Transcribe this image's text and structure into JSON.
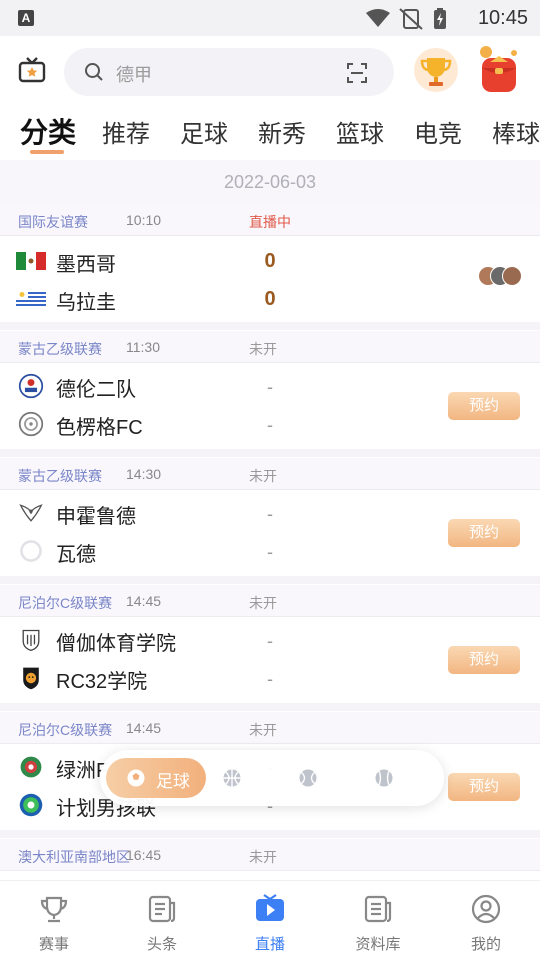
{
  "status_bar": {
    "time": "10:45",
    "app_badge": "A"
  },
  "search": {
    "placeholder": "德甲"
  },
  "tabs": [
    "分类",
    "推荐",
    "足球",
    "新秀",
    "篮球",
    "电竞",
    "棒球"
  ],
  "date": "2022-06-03",
  "matches": [
    {
      "league": "国际友谊赛",
      "time": "10:10",
      "status": "直播中",
      "home": "墨西哥",
      "away": "乌拉圭",
      "home_score": "0",
      "away_score": "0"
    },
    {
      "league": "蒙古乙级联赛",
      "time": "11:30",
      "status": "未开",
      "home": "德伦二队",
      "away": "色楞格FC",
      "home_score": "-",
      "away_score": "-",
      "action": "预约"
    },
    {
      "league": "蒙古乙级联赛",
      "time": "14:30",
      "status": "未开",
      "home": "申霍鲁德",
      "away": "瓦德",
      "home_score": "-",
      "away_score": "-",
      "action": "预约"
    },
    {
      "league": "尼泊尔C级联赛",
      "time": "14:45",
      "status": "未开",
      "home": "僧伽体育学院",
      "away": "RC32学院",
      "home_score": "-",
      "away_score": "-",
      "action": "预约"
    },
    {
      "league": "尼泊尔C级联赛",
      "time": "14:45",
      "status": "未开",
      "home": "绿洲F",
      "away": "计划男孩联",
      "home_score": "-",
      "away_score": "-",
      "action": "预约"
    },
    {
      "league": "澳大利亚南部地区",
      "time": "16:45",
      "status": "未开"
    }
  ],
  "sport_switch": {
    "active": "足球"
  },
  "bottom_nav": [
    "赛事",
    "头条",
    "直播",
    "资料库",
    "我的"
  ],
  "colors": {
    "accent": "#3d7ff5",
    "live": "#e05a4a",
    "league": "#7a86c8",
    "book": "#f2b682"
  }
}
